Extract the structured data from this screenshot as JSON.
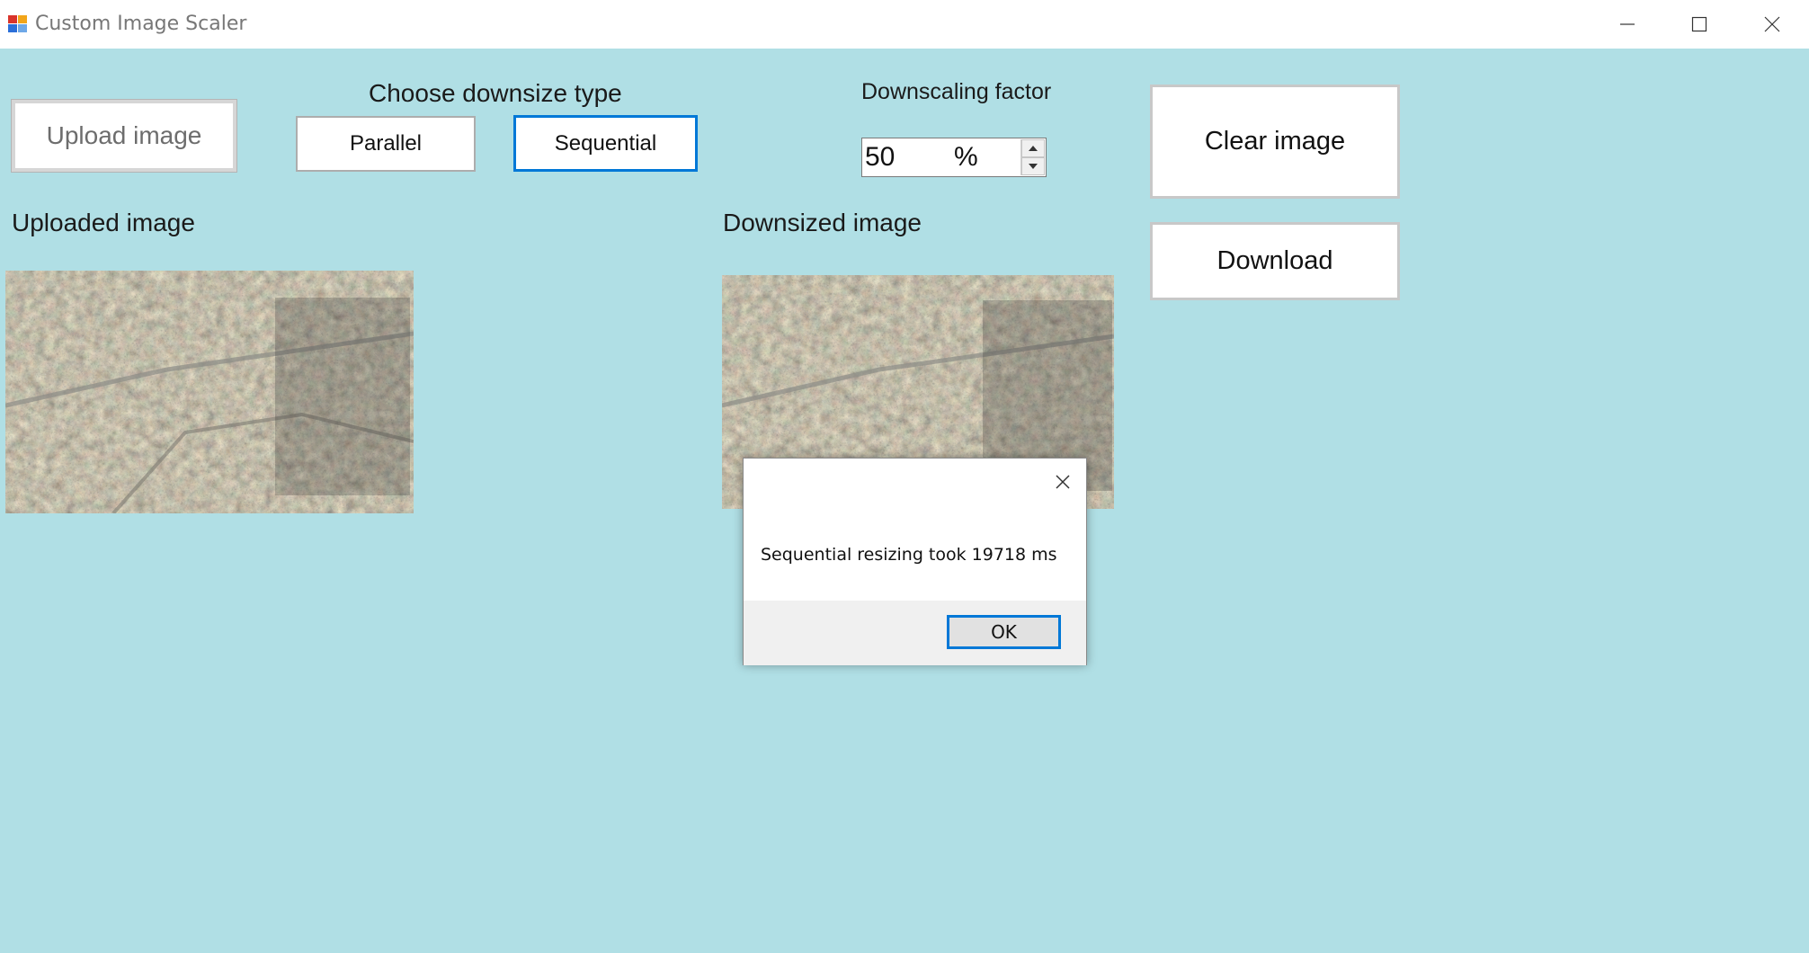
{
  "window": {
    "title": "Custom Image Scaler",
    "icon": "app-window-icon",
    "controls": [
      "minimize-icon",
      "maximize-icon",
      "close-icon"
    ]
  },
  "toolbar": {
    "upload_label": "Upload image",
    "downsize_type_label": "Choose downsize type",
    "parallel_label": "Parallel",
    "sequential_label": "Sequential",
    "factor_label": "Downscaling factor",
    "factor_value": "50",
    "factor_unit": "%",
    "clear_label": "Clear image",
    "download_label": "Download"
  },
  "panels": {
    "uploaded_label": "Uploaded image",
    "downsized_label": "Downsized image",
    "image_content": "aerial-city-photo"
  },
  "dialog": {
    "message": "Sequential resizing took 19718 ms",
    "ok_label": "OK"
  },
  "colors": {
    "background": "#b0dfe5",
    "accent": "#0078d7"
  }
}
